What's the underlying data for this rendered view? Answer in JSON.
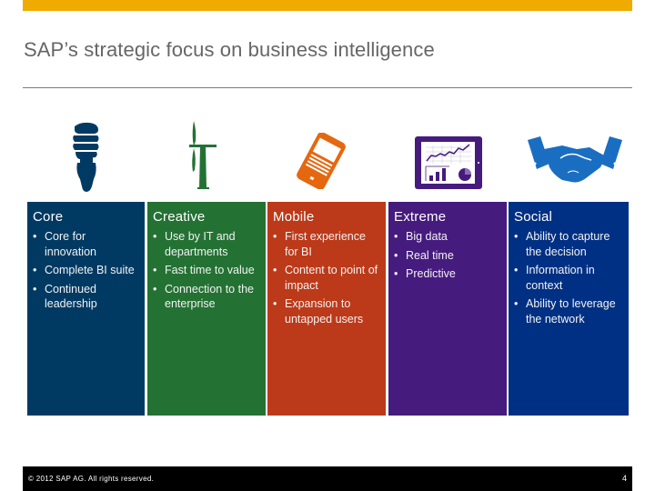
{
  "slide": {
    "title": "SAP’s strategic focus on business intelligence",
    "accent_color": "#f0ab00"
  },
  "columns": [
    {
      "heading": "Core",
      "icon": "light-bulb-icon",
      "color": "#003a63",
      "bullets": [
        "Core for innovation",
        "Complete BI suite",
        "Continued leadership"
      ]
    },
    {
      "heading": "Creative",
      "icon": "wind-turbine-icon",
      "color": "#237233",
      "bullets": [
        "Use by IT and departments",
        "Fast time to value",
        "Connection to the enterprise"
      ]
    },
    {
      "heading": "Mobile",
      "icon": "mobile-phone-icon",
      "color": "#bc3a19",
      "bullets": [
        "First experience for BI",
        "Content to point of impact",
        "Expansion to untapped users"
      ]
    },
    {
      "heading": "Extreme",
      "icon": "tablet-analytics-icon",
      "color": "#461b7e",
      "bullets": [
        "Big data",
        "Real time",
        "Predictive"
      ]
    },
    {
      "heading": "Social",
      "icon": "handshake-icon",
      "color": "#003084",
      "bullets": [
        "Ability to capture the decision",
        "Information in context",
        "Ability to leverage the network"
      ]
    }
  ],
  "footer": {
    "copyright": "© 2012 SAP AG. All rights reserved.",
    "page_number": "4"
  }
}
